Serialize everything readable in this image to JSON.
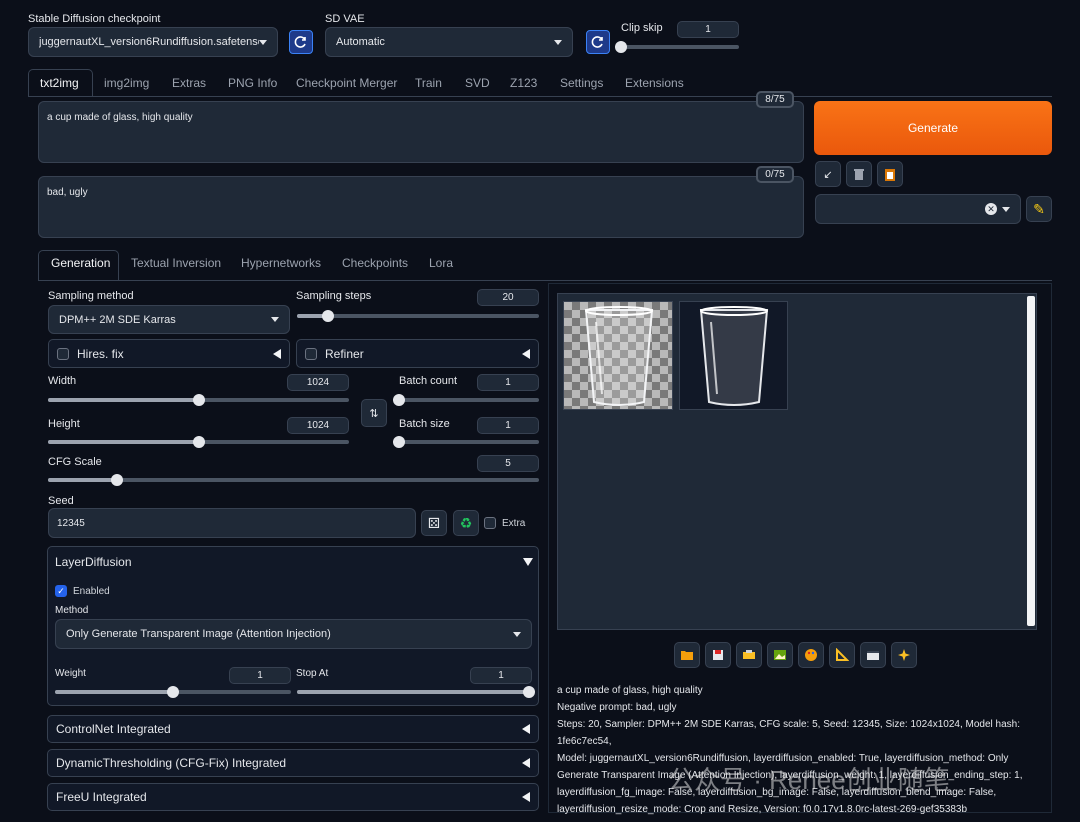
{
  "header": {
    "checkpoint_label": "Stable Diffusion checkpoint",
    "checkpoint_value": "juggernautXL_version6Rundiffusion.safetensors",
    "vae_label": "SD VAE",
    "vae_value": "Automatic",
    "clipskip_label": "Clip skip",
    "clipskip_value": "1"
  },
  "tabs": [
    "txt2img",
    "img2img",
    "Extras",
    "PNG Info",
    "Checkpoint Merger",
    "Train",
    "SVD",
    "Z123",
    "Settings",
    "Extensions"
  ],
  "prompt": {
    "positive": "a cup made of glass, high quality",
    "positive_count": "8/75",
    "negative": "bad, ugly",
    "negative_count": "0/75"
  },
  "generate_label": "Generate",
  "gen_tabs": [
    "Generation",
    "Textual Inversion",
    "Hypernetworks",
    "Checkpoints",
    "Lora"
  ],
  "generation": {
    "sampling_method_label": "Sampling method",
    "sampling_method_value": "DPM++ 2M SDE Karras",
    "sampling_steps_label": "Sampling steps",
    "sampling_steps_value": "20",
    "sampling_steps_fraction": 0.13,
    "hires_label": "Hires. fix",
    "refiner_label": "Refiner",
    "width_label": "Width",
    "width_value": "1024",
    "width_fraction": 0.5,
    "height_label": "Height",
    "height_value": "1024",
    "height_fraction": 0.5,
    "batch_count_label": "Batch count",
    "batch_count_value": "1",
    "batch_size_label": "Batch size",
    "batch_size_value": "1",
    "cfg_label": "CFG Scale",
    "cfg_value": "5",
    "cfg_fraction": 0.14,
    "seed_label": "Seed",
    "seed_value": "12345",
    "extra_label": "Extra"
  },
  "layerdiffusion": {
    "title": "LayerDiffusion",
    "enabled_label": "Enabled",
    "method_label": "Method",
    "method_value": "Only Generate Transparent Image (Attention Injection)",
    "weight_label": "Weight",
    "weight_value": "1",
    "weight_fraction": 0.5,
    "stop_label": "Stop At",
    "stop_value": "1",
    "stop_fraction": 1.0
  },
  "accordions": [
    "ControlNet Integrated",
    "DynamicThresholding (CFG-Fix) Integrated",
    "FreeU Integrated"
  ],
  "output": {
    "info_lines": [
      "a cup made of glass, high quality",
      "Negative prompt: bad, ugly",
      "Steps: 20, Sampler: DPM++ 2M SDE Karras, CFG scale: 5, Seed: 12345, Size: 1024x1024, Model hash: 1fe6c7ec54,",
      "Model: juggernautXL_version6Rundiffusion, layerdiffusion_enabled: True, layerdiffusion_method: Only",
      "Generate Transparent Image (Attention Injection), layerdiffusion_weight: 1, layerdiffusion_ending_step: 1,",
      "layerdiffusion_fg_image: False, layerdiffusion_bg_image: False, layerdiffusion_blend_image: False,",
      "layerdiffusion_resize_mode: Crop and Resize, Version: f0.0.17v1.8.0rc-latest-269-gef35383b"
    ],
    "tools": [
      "folder-icon",
      "save-icon",
      "zip-icon",
      "image-icon",
      "palette-icon",
      "ruler-icon",
      "film-icon",
      "sparkle-icon"
    ]
  },
  "watermark": "公众号 · Renee创业随笔",
  "colors": {
    "accent": "#f97316",
    "background": "#0b0f19",
    "panel": "#1f2937",
    "checkbox": "#2563eb"
  }
}
